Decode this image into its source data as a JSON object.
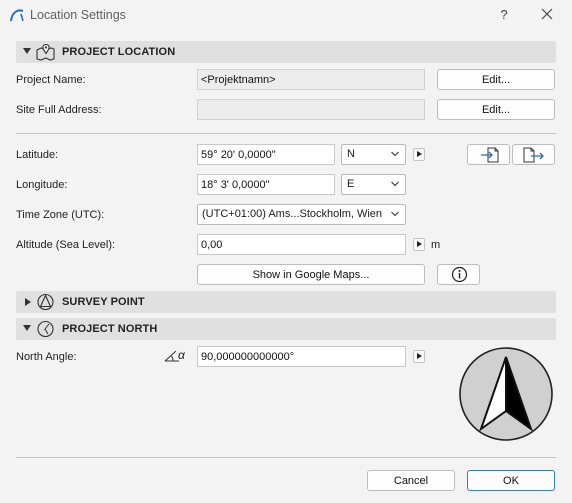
{
  "window": {
    "title": "Location Settings",
    "help_glyph": "?"
  },
  "project_location": {
    "header": "PROJECT LOCATION",
    "project_name_label": "Project Name:",
    "project_name_value": "<Projektnamn>",
    "site_address_label": "Site Full Address:",
    "site_address_value": "",
    "edit_label": "Edit...",
    "latitude_label": "Latitude:",
    "latitude_value": "59° 20' 0,0000\"",
    "latitude_dir": "N",
    "longitude_label": "Longitude:",
    "longitude_value": "18° 3' 0,0000\"",
    "longitude_dir": "E",
    "timezone_label": "Time Zone (UTC):",
    "timezone_value": "(UTC+01:00) Ams...Stockholm, Wien",
    "altitude_label": "Altitude (Sea Level):",
    "altitude_value": "0,00",
    "altitude_unit": "m",
    "maps_button": "Show in Google Maps..."
  },
  "survey_point": {
    "header": "SURVEY POINT"
  },
  "project_north": {
    "header": "PROJECT NORTH",
    "north_angle_label": "North Angle:",
    "north_angle_value": "90,000000000000°",
    "angle_symbol": "α"
  },
  "footer": {
    "cancel_label": "Cancel",
    "ok_label": "OK"
  },
  "icons": {
    "app": "archicad-arc-icon",
    "location": "map-pin-icon",
    "survey": "survey-point-icon",
    "north": "compass-icon",
    "import": "import-icon",
    "export": "export-icon",
    "info": "info-icon"
  },
  "colors": {
    "section_bg": "#e0e0e0",
    "ok_border": "#3a78c2",
    "app_icon": "#2f6db5"
  }
}
